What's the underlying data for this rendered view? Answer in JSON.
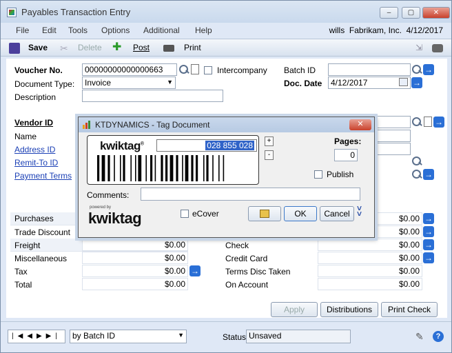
{
  "window": {
    "title": "Payables Transaction Entry",
    "min": "–",
    "max": "▢",
    "close": "✕"
  },
  "menu": {
    "items": [
      "File",
      "Edit",
      "Tools",
      "Options",
      "Additional",
      "Help"
    ],
    "user": "wills",
    "company": "Fabrikam, Inc.",
    "date": "4/12/2017"
  },
  "toolbar": {
    "save": "Save",
    "delete": "Delete",
    "post": "Post",
    "print": "Print"
  },
  "form": {
    "voucher_label": "Voucher No.",
    "voucher_value": "00000000000000663",
    "intercompany_label": "Intercompany",
    "batch_label": "Batch ID",
    "batch_value": "",
    "doctype_label": "Document Type:",
    "doctype_value": "Invoice",
    "docdate_label": "Doc. Date",
    "docdate_value": "4/12/2017",
    "description_label": "Description",
    "description_value": "",
    "vendor_label": "Vendor ID",
    "name_label": "Name",
    "address_label": "Address ID",
    "remit_label": "Remit-To ID",
    "terms_label": "Payment Terms",
    "left_amounts": [
      {
        "label": "Purchases",
        "value": ""
      },
      {
        "label": "Trade Discount",
        "value": ""
      },
      {
        "label": "Freight",
        "value": "$0.00"
      },
      {
        "label": "Miscellaneous",
        "value": "$0.00"
      },
      {
        "label": "Tax",
        "value": "$0.00"
      },
      {
        "label": "Total",
        "value": "$0.00"
      }
    ],
    "right_amounts": [
      {
        "label": "",
        "value": "$0.00"
      },
      {
        "label": "",
        "value": "$0.00"
      },
      {
        "label": "Check",
        "value": "$0.00"
      },
      {
        "label": "Credit Card",
        "value": "$0.00"
      },
      {
        "label": "Terms Disc Taken",
        "value": "$0.00"
      },
      {
        "label": "On Account",
        "value": "$0.00"
      }
    ],
    "apply": "Apply",
    "distributions": "Distributions",
    "print_check": "Print Check"
  },
  "footer": {
    "sort_value": "by Batch ID",
    "status_label": "Status",
    "status_value": "Unsaved"
  },
  "dialog": {
    "title": "KTDYNAMICS - Tag Document",
    "close": "✕",
    "brand": "kwiktag",
    "tag_number": "028 855 028",
    "plus": "+",
    "minus": "-",
    "pages_label": "Pages:",
    "pages_value": "0",
    "publish_label": "Publish",
    "comments_label": "Comments:",
    "comments_value": "",
    "powered_by": "powered by",
    "ecover_label": "eCover",
    "ok": "OK",
    "cancel": "Cancel"
  }
}
